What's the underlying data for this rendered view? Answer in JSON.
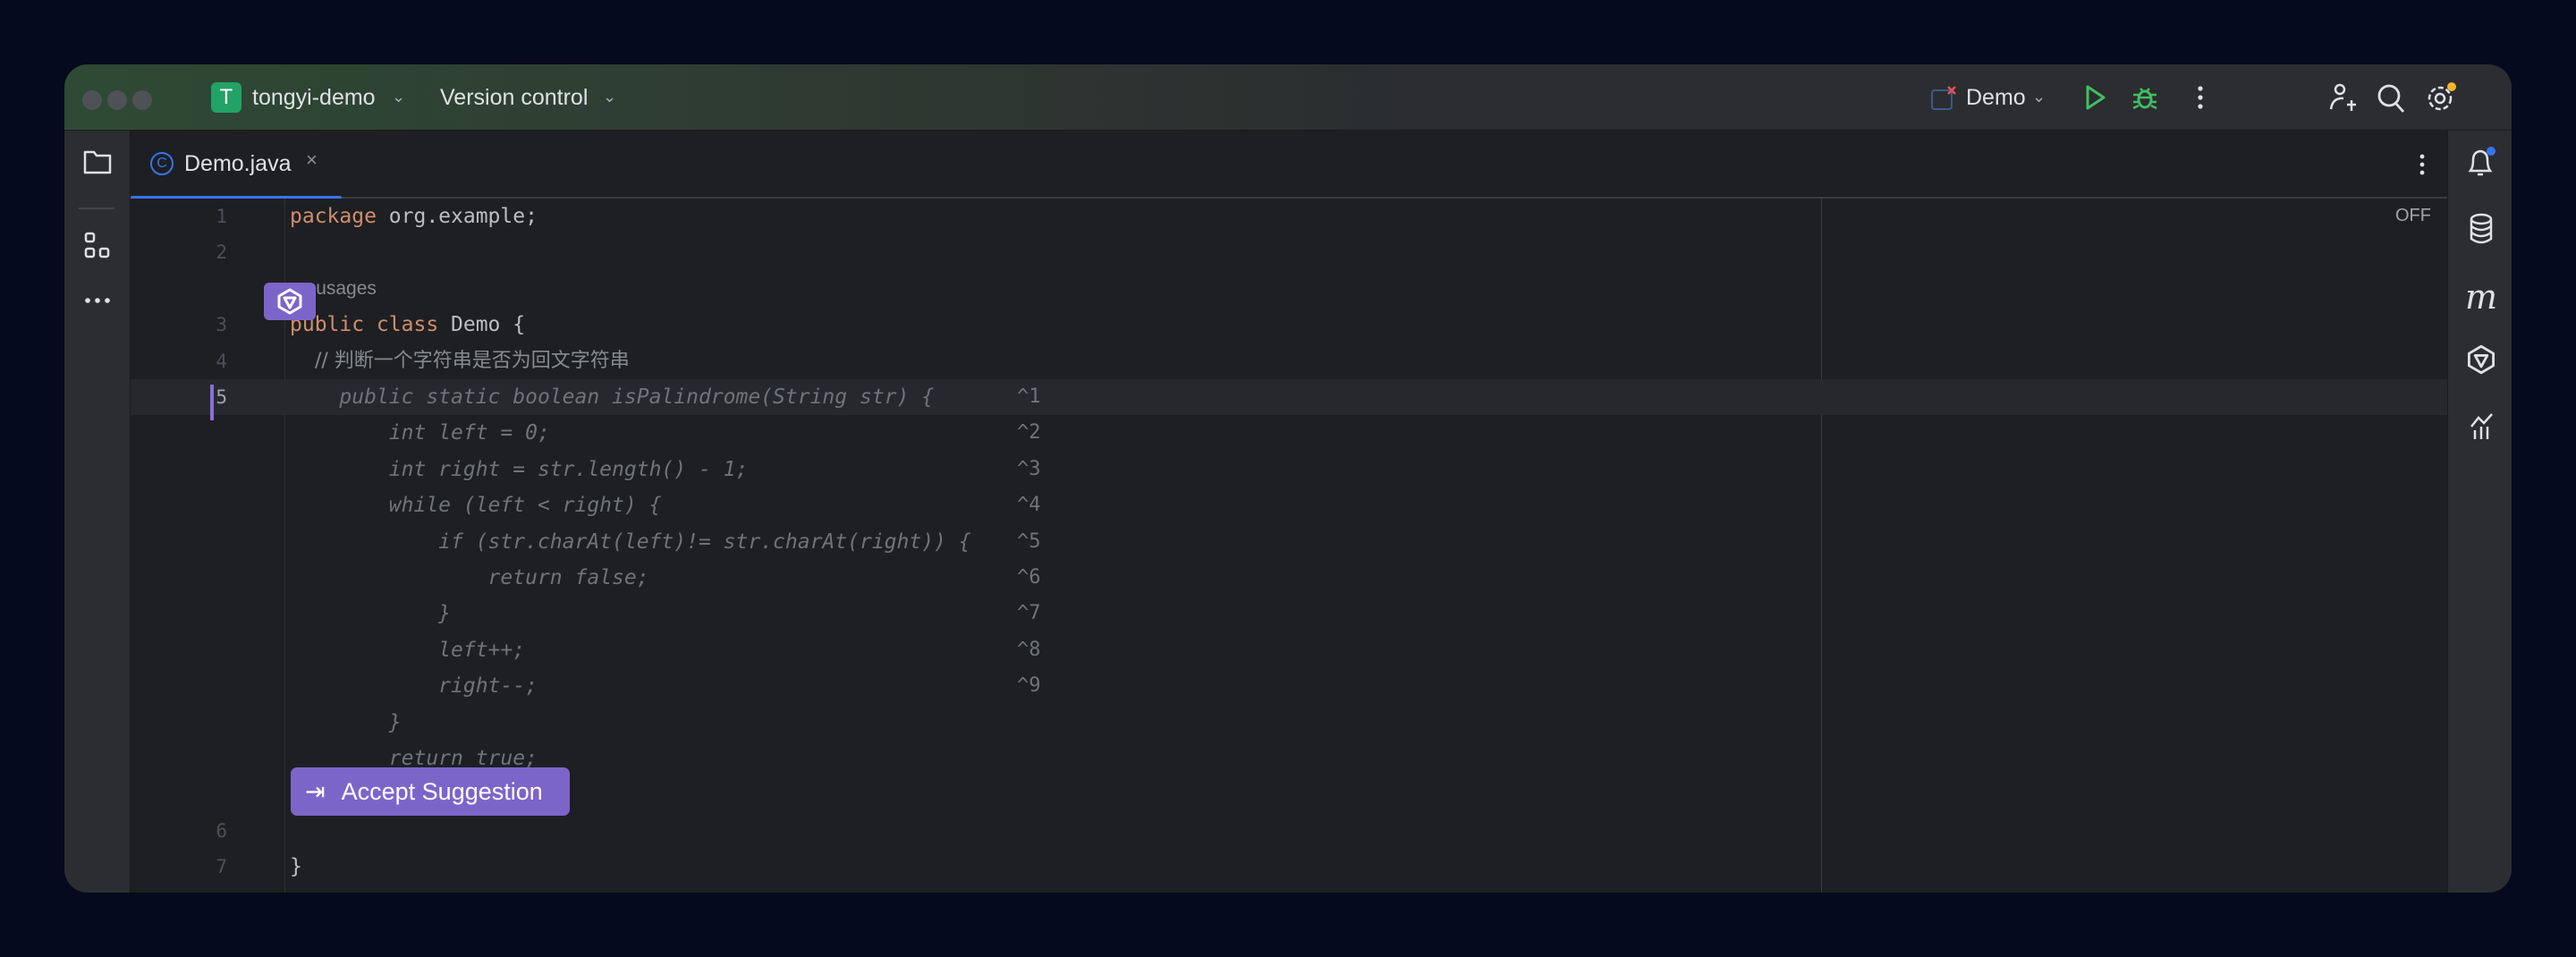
{
  "titlebar": {
    "project_initial": "T",
    "project_name": "tongyi-demo",
    "vcs_label": "Version control",
    "run_config": "Demo"
  },
  "tab": {
    "label": "Demo.java",
    "file_icon": "C"
  },
  "editor": {
    "off_label": "OFF",
    "no_usages": "no usages",
    "lines": [
      {
        "num": "1",
        "code": "package org.example;"
      },
      {
        "num": "2",
        "code": ""
      },
      {
        "num": "3",
        "code": "public class Demo {"
      },
      {
        "num": "4",
        "code": "    // 判断一个字符串是否为回文字符串"
      },
      {
        "num": "5",
        "code": "    public static boolean isPalindrome(String str) {"
      },
      {
        "num": "6",
        "code": ""
      },
      {
        "num": "7",
        "code": "}"
      }
    ],
    "suggestion": [
      {
        "text": "        int left = 0;",
        "shortcut": "^2"
      },
      {
        "text": "        int right = str.length() - 1;",
        "shortcut": "^3"
      },
      {
        "text": "        while (left < right) {",
        "shortcut": "^4"
      },
      {
        "text": "            if (str.charAt(left)!= str.charAt(right)) {",
        "shortcut": "^5"
      },
      {
        "text": "                return false;",
        "shortcut": "^6"
      },
      {
        "text": "            }",
        "shortcut": "^7"
      },
      {
        "text": "            left++;",
        "shortcut": "^8"
      },
      {
        "text": "            right--;",
        "shortcut": "^9"
      },
      {
        "text": "        }",
        "shortcut": ""
      },
      {
        "text": "        return true;",
        "shortcut": ""
      },
      {
        "text": "    }",
        "shortcut": ""
      }
    ],
    "line5_shortcut": "^1",
    "accept_label": "Accept Suggestion"
  },
  "colors": {
    "accent": "#3574f0",
    "ai": "#7c65c9",
    "run": "#3fbf5f",
    "keyword": "#cf8e6d"
  }
}
